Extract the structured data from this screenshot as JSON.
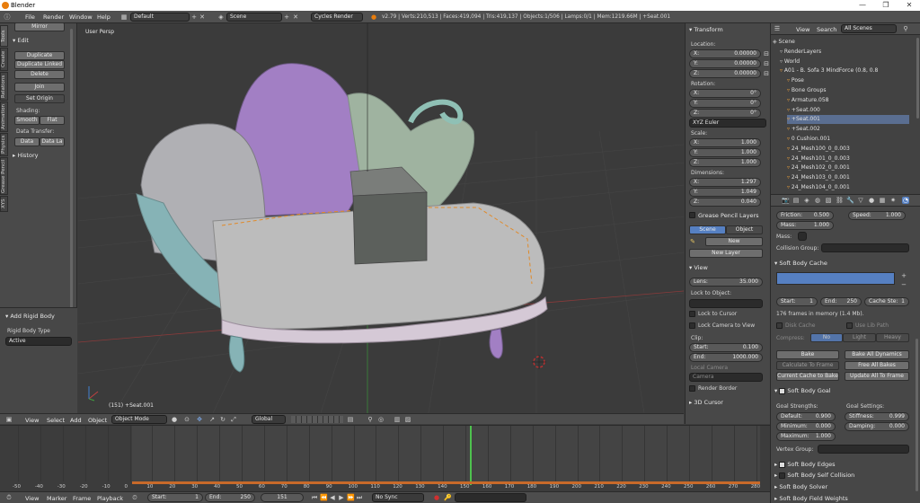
{
  "window": {
    "title": "Blender",
    "minimize": "—",
    "restore": "❐",
    "close": "✕"
  },
  "menubar": {
    "items": [
      "File",
      "Render",
      "Window",
      "Help"
    ],
    "layout": "Default",
    "scene": "Scene",
    "engine": "Cycles Render",
    "stats": "v2.79 | Verts:210,513 | Faces:419,094 | Tris:419,137 | Objects:1/506 | Lamps:0/1 | Mem:1219.66M | +Seat.001"
  },
  "tool_shelf": {
    "tabs": [
      "Tools",
      "Create",
      "Relations",
      "Animation",
      "Physics",
      "Grease Pencil",
      "XYS"
    ],
    "mirror": "Mirror",
    "edit_header": "Edit",
    "duplicate": "Duplicate",
    "duplicate_linked": "Duplicate Linked",
    "delete": "Delete",
    "join": "Join",
    "set_origin": "Set Origin",
    "shading_label": "Shading:",
    "smooth": "Smooth",
    "flat": "Flat",
    "data_transfer_label": "Data Transfer:",
    "data": "Data",
    "data_layout": "Data La",
    "history": "History",
    "add_rigid_body": "Add Rigid Body",
    "rigid_body_type_label": "Rigid Body Type",
    "rigid_body_type": "Active"
  },
  "viewport": {
    "label": "User Persp",
    "object_info": "(151) +Seat.001",
    "menu": [
      "View",
      "Select",
      "Add",
      "Object"
    ],
    "mode": "Object Mode",
    "orientation": "Global"
  },
  "properties_n": {
    "transform": "Transform",
    "location_label": "Location:",
    "location": [
      {
        "axis": "X:",
        "value": "0.00000"
      },
      {
        "axis": "Y:",
        "value": "0.00000"
      },
      {
        "axis": "Z:",
        "value": "0.00000"
      }
    ],
    "rotation_label": "Rotation:",
    "rotation": [
      {
        "axis": "X:",
        "value": "0°"
      },
      {
        "axis": "Y:",
        "value": "0°"
      },
      {
        "axis": "Z:",
        "value": "0°"
      }
    ],
    "rotation_mode": "XYZ Euler",
    "scale_label": "Scale:",
    "scale": [
      {
        "axis": "X:",
        "value": "1.000"
      },
      {
        "axis": "Y:",
        "value": "1.000"
      },
      {
        "axis": "Z:",
        "value": "1.000"
      }
    ],
    "dimensions_label": "Dimensions:",
    "dimensions": [
      {
        "axis": "X:",
        "value": "1.297"
      },
      {
        "axis": "Y:",
        "value": "1.049"
      },
      {
        "axis": "Z:",
        "value": "0.040"
      }
    ],
    "grease_pencil_layers": "Grease Pencil Layers",
    "scene_tab": "Scene",
    "object_tab": "Object",
    "new": "New",
    "new_layer": "New Layer",
    "view_header": "View",
    "lens_label": "Lens:",
    "lens_value": "35.000",
    "lock_to_object": "Lock to Object:",
    "lock_to_cursor": "Lock to Cursor",
    "lock_camera_to_view": "Lock Camera to View",
    "clip_label": "Clip:",
    "clip_start_label": "Start:",
    "clip_start": "0.100",
    "clip_end_label": "End:",
    "clip_end": "1000.000",
    "local_camera": "Local Camera",
    "camera": "Camera",
    "render_border": "Render Border",
    "cursor_3d": "3D Cursor"
  },
  "outliner": {
    "view": "View",
    "search": "Search",
    "filter": "All Scenes",
    "rows": [
      {
        "label": "Scene",
        "indent": 0,
        "sel": false
      },
      {
        "label": "RenderLayers",
        "indent": 1,
        "sel": false
      },
      {
        "label": "World",
        "indent": 1,
        "sel": false
      },
      {
        "label": "A01 - B. Sofa 3 MindForce (0.8, 0.8",
        "indent": 1,
        "sel": false
      },
      {
        "label": "Pose",
        "indent": 2,
        "sel": false
      },
      {
        "label": "Bone Groups",
        "indent": 2,
        "sel": false
      },
      {
        "label": "Armature.058",
        "indent": 2,
        "sel": false
      },
      {
        "label": "+Seat.000",
        "indent": 2,
        "sel": false
      },
      {
        "label": "+Seat.001",
        "indent": 2,
        "sel": true
      },
      {
        "label": "+Seat.002",
        "indent": 2,
        "sel": false
      },
      {
        "label": "0 Cushion.001",
        "indent": 2,
        "sel": false
      },
      {
        "label": "24_Mesh100_0_0.003",
        "indent": 2,
        "sel": false
      },
      {
        "label": "24_Mesh101_0_0.003",
        "indent": 2,
        "sel": false
      },
      {
        "label": "24_Mesh102_0_0.001",
        "indent": 2,
        "sel": false
      },
      {
        "label": "24_Mesh103_0_0.001",
        "indent": 2,
        "sel": false
      },
      {
        "label": "24_Mesh104_0_0.001",
        "indent": 2,
        "sel": false
      }
    ]
  },
  "physics": {
    "friction_label": "Friction:",
    "friction": "0.500",
    "speed_label": "Speed:",
    "speed": "1.000",
    "mass_label": "Mass:",
    "mass": "1.000",
    "mass2_label": "Mass:",
    "collision_group": "Collision Group:",
    "soft_body_cache": "Soft Body Cache",
    "start_label": "Start:",
    "start": "1",
    "end_label": "End:",
    "end": "250",
    "cache_step_label": "Cache Ste:",
    "cache_step": "1",
    "frames_in_memory": "176 frames in memory (1.4 Mb).",
    "disk_cache": "Disk Cache",
    "use_lib_path": "Use Lib Path",
    "compress_label": "Compress:",
    "compress_no": "No",
    "compress_light": "Light",
    "compress_heavy": "Heavy",
    "bake": "Bake",
    "bake_all_dynamics": "Bake All Dynamics",
    "calculate_to_frame": "Calculate To Frame",
    "free_all_bakes": "Free All Bakes",
    "current_cache_to_bake": "Current Cache to Bake",
    "update_all_to_frame": "Update All To Frame",
    "soft_body_goal": "Soft Body Goal",
    "goal_strengths": "Goal Strengths:",
    "goal_settings": "Goal Settings:",
    "default_label": "Default:",
    "default": "0.900",
    "stiffness_label": "Stiffness:",
    "stiffness": "0.999",
    "minimum_label": "Minimum:",
    "minimum": "0.000",
    "damping_label": "Damping:",
    "damping": "0.000",
    "maximum_label": "Maximum:",
    "maximum": "1.000",
    "vertex_group": "Vertex Group:",
    "soft_body_edges": "Soft Body Edges",
    "soft_body_self_collision": "Soft Body Self Collision",
    "soft_body_solver": "Soft Body Solver",
    "soft_body_field_weights": "Soft Body Field Weights"
  },
  "timeline": {
    "ticks": [
      "-50",
      "-40",
      "-30",
      "-20",
      "-10",
      "0",
      "10",
      "20",
      "30",
      "40",
      "50",
      "60",
      "70",
      "80",
      "90",
      "100",
      "110",
      "120",
      "130",
      "140",
      "150",
      "160",
      "170",
      "180",
      "190",
      "200",
      "210",
      "220",
      "230",
      "240",
      "250",
      "260",
      "270",
      "280"
    ],
    "menu": [
      "View",
      "Marker",
      "Frame",
      "Playback"
    ],
    "start_label": "Start:",
    "start": "1",
    "end_label": "End:",
    "end": "250",
    "current_frame": "151",
    "sync": "No Sync"
  }
}
